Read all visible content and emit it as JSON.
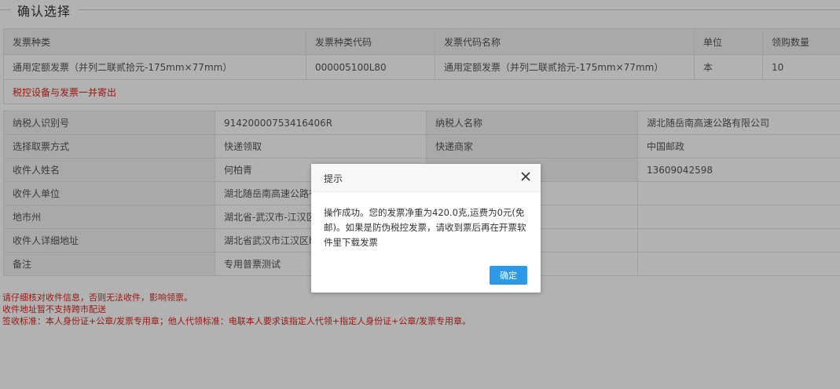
{
  "section_title": "确认选择",
  "invoice_table": {
    "headers": [
      "发票种类",
      "发票种类代码",
      "发票代码名称",
      "单位",
      "领购数量"
    ],
    "row": [
      "通用定额发票（并列二联贰拾元-175mm×77mm）",
      "000005100L80",
      "通用定额发票（并列二联贰拾元-175mm×77mm）",
      "本",
      "10"
    ],
    "note": "税控设备与发票一并寄出"
  },
  "info_table": {
    "rows": [
      {
        "l1": "纳税人识别号",
        "v1": "91420000753416406R",
        "l2": "纳税人名称",
        "v2": "湖北随岳南高速公路有限公司"
      },
      {
        "l1": "选择取票方式",
        "v1": "快递领取",
        "l2": "快递商家",
        "v2": "中国邮政"
      },
      {
        "l1": "收件人姓名",
        "v1": "何柏青",
        "l2": "",
        "v2": "13609042598"
      },
      {
        "l1": "收件人单位",
        "v1": "湖北随岳南高速公路有",
        "l2": "",
        "v2": ""
      },
      {
        "l1": "地市州",
        "v1": "湖北省-武汉市-江汉区",
        "l2": "",
        "v2": ""
      },
      {
        "l1": "收件人详细地址",
        "v1": "湖北省武汉市江汉区hk",
        "l2": "",
        "v2": ""
      },
      {
        "l1": "备注",
        "v1": "专用普票测试",
        "l2": "",
        "v2": ""
      }
    ]
  },
  "warnings": [
    "请仔细核对收件信息，否则无法收件，影响领票。",
    "收件地址暂不支持跨市配送",
    "签收标准：本人身份证+公章/发票专用章；他人代领标准：电联本人要求该指定人代领+指定人身份证+公章/发票专用章。"
  ],
  "dialog": {
    "title": "提示",
    "message": "操作成功。您的发票净重为420.0克,运费为0元(免邮)。如果是防伪税控发票，请收到票后再在开票软件里下载发票",
    "ok_label": "确定"
  }
}
